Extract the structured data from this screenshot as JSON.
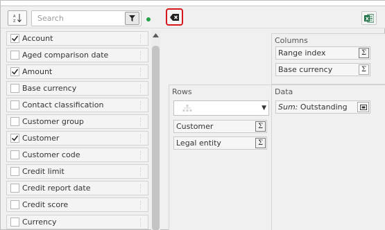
{
  "toolbar": {
    "search_placeholder": "Search",
    "sort_icon": "sort-az-icon",
    "filter_icon": "filter-icon",
    "clear_icon": "clear-filter-icon",
    "excel_icon": "excel-export-icon",
    "status_color": "#22a046",
    "clear_border_color": "#d7161c"
  },
  "fields": [
    {
      "label": "Account",
      "checked": true
    },
    {
      "label": "Aged comparison date",
      "checked": false
    },
    {
      "label": "Amount",
      "checked": true
    },
    {
      "label": "Base currency",
      "checked": false
    },
    {
      "label": "Contact classification",
      "checked": false
    },
    {
      "label": "Customer group",
      "checked": false
    },
    {
      "label": "Customer",
      "checked": true
    },
    {
      "label": "Customer code",
      "checked": false
    },
    {
      "label": "Credit limit",
      "checked": false
    },
    {
      "label": "Credit report date",
      "checked": false
    },
    {
      "label": "Credit score",
      "checked": false
    },
    {
      "label": "Currency",
      "checked": false
    }
  ],
  "zones": {
    "columns": {
      "title": "Columns",
      "items": [
        "Range index",
        "Base currency"
      ]
    },
    "rows": {
      "title": "Rows",
      "items": [
        "Customer",
        "Legal entity"
      ]
    },
    "data": {
      "title": "Data",
      "items": [
        {
          "aggregate": "Sum:",
          "field": "Outstanding"
        }
      ]
    }
  },
  "sigma_symbol": "Σ"
}
